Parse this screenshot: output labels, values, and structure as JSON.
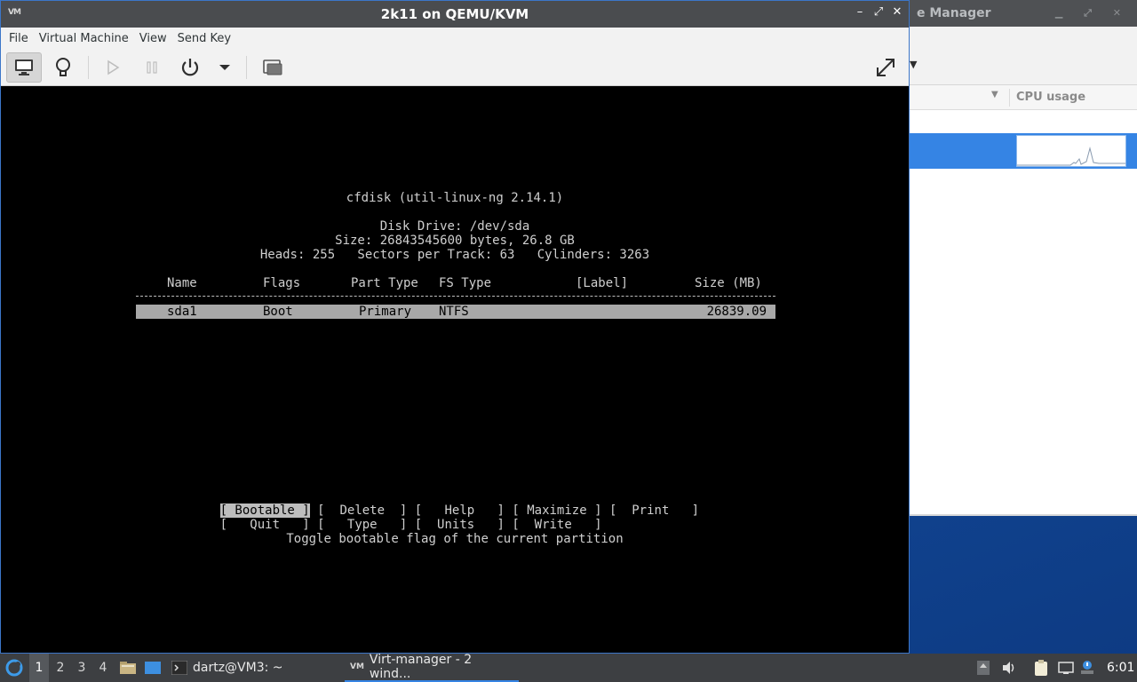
{
  "colors": {
    "accent": "#3584e4",
    "titlebar": "#4a4c4f",
    "terminal_bg": "#000000",
    "terminal_fg": "#cfcfcf",
    "selection": "#a8a8a8"
  },
  "bg_window": {
    "title_fragment": "e Manager",
    "column_header": "CPU usage"
  },
  "window": {
    "title": "2k11 on QEMU/KVM",
    "menu": [
      "File",
      "Virtual Machine",
      "View",
      "Send Key"
    ],
    "toolbar_icons": [
      "monitor-icon",
      "lightbulb-icon",
      "play-icon",
      "pause-icon",
      "power-icon",
      "dropdown-arrow-icon",
      "screenshot-icon",
      "fullscreen-icon"
    ]
  },
  "cfdisk": {
    "title": "cfdisk (util-linux-ng 2.14.1)",
    "disk_drive": "Disk Drive: /dev/sda",
    "size_line": "Size: 26843545600 bytes, 26.8 GB",
    "geometry_line": "Heads: 255   Sectors per Track: 63   Cylinders: 3263",
    "columns": [
      "Name",
      "Flags",
      "Part Type",
      "FS Type",
      "[Label]",
      "Size (MB)"
    ],
    "partitions": [
      {
        "name": "sda1",
        "flags": "Boot",
        "part_type": "Primary",
        "fs_type": "NTFS",
        "label": "",
        "size_mb": "26839.09"
      }
    ],
    "commands_row1": [
      "[ Bootable ]",
      "[  Delete  ]",
      "[   Help   ]",
      "[ Maximize ]",
      "[  Print   ]"
    ],
    "commands_row2": [
      "[   Quit   ]",
      "[   Type   ]",
      "[  Units   ]",
      "[  Write   ]"
    ],
    "selected_command": "[ Bootable ]",
    "help_text": "Toggle bootable flag of the current partition"
  },
  "taskbar": {
    "workspaces": [
      "1",
      "2",
      "3",
      "4"
    ],
    "active_workspace": "1",
    "terminal_task": "dartz@VM3: ~",
    "virt_task": "Virt-manager - 2 wind...",
    "clock": "6:01"
  }
}
